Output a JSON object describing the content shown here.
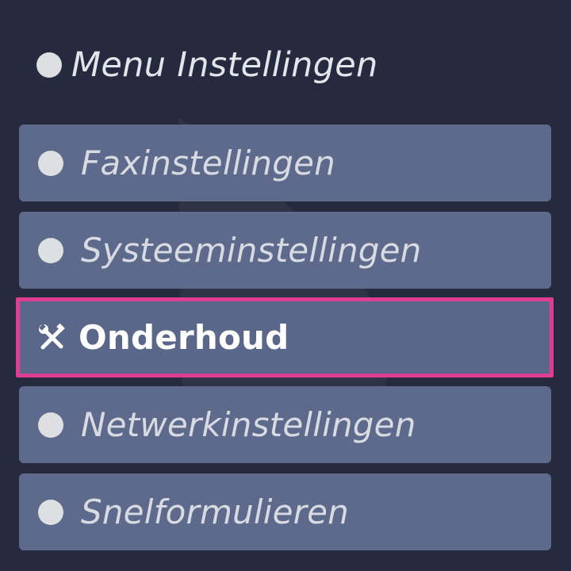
{
  "menu": {
    "title": "Menu Instellingen",
    "items": [
      {
        "label": "Faxinstellingen",
        "icon": "bullet-icon",
        "selected": false
      },
      {
        "label": "Systeeminstellingen",
        "icon": "bullet-icon",
        "selected": false
      },
      {
        "label": "Onderhoud",
        "icon": "tools-icon",
        "selected": true
      },
      {
        "label": "Netwerkinstellingen",
        "icon": "bullet-icon",
        "selected": false
      },
      {
        "label": "Snelformulieren",
        "icon": "bullet-icon",
        "selected": false
      }
    ]
  },
  "colors": {
    "background": "#252a3e",
    "item_background": "#5e6a8c",
    "selection_border": "#df3d93",
    "text": "#d9dbe3"
  }
}
